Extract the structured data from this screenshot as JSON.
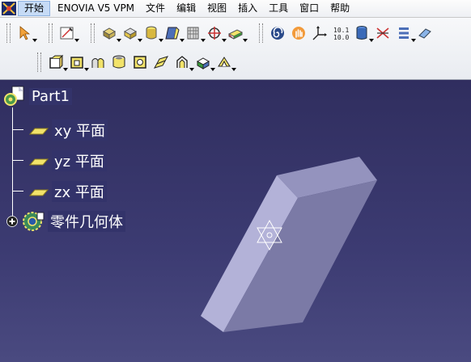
{
  "menubar": {
    "items": [
      "开始",
      "ENOVIA V5 VPM",
      "文件",
      "编辑",
      "视图",
      "插入",
      "工具",
      "窗口",
      "帮助"
    ]
  },
  "toolbar": {
    "row1_icons": [
      "select-arrow-icon",
      "sketcher-icon",
      "pad-icon",
      "pocket-icon",
      "shaft-icon",
      "groove-icon",
      "hole-icon",
      "point-icon",
      "plane-icon",
      "spiral-icon",
      "hand-icon",
      "axis-system-icon",
      "parameters-icon",
      "database-icon",
      "measure-icon",
      "list-icon",
      "eraser-icon"
    ],
    "row2_icons": [
      "edge-fillet-icon",
      "chamfer-icon",
      "draft-icon",
      "shell-icon",
      "thickness-icon",
      "thread-icon",
      "rib-icon",
      "slot-icon",
      "stiffener-icon"
    ]
  },
  "tree": {
    "root": "Part1",
    "children": [
      "xy 平面",
      "yz 平面",
      "zx 平面"
    ],
    "body": "零件几何体"
  },
  "colors": {
    "viewport_top": "#302e5f",
    "viewport_bottom": "#4a4a80",
    "part_front": "#7b7aa6",
    "part_side": "#b3b2d8",
    "part_top": "#9493be",
    "plane_icon": "#f2e36a"
  }
}
